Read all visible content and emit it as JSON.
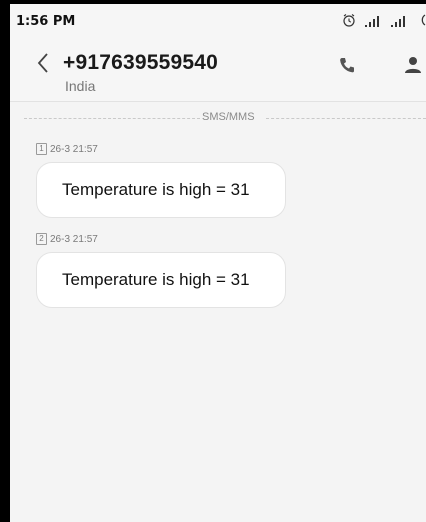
{
  "status_bar": {
    "time": "1:56 PM",
    "icons": [
      "alarm-icon",
      "signal-icon",
      "signal-icon",
      "battery-icon"
    ]
  },
  "header": {
    "title": "+917639559540",
    "subtitle": "India",
    "back_icon": "chevron-left-icon",
    "call_icon": "phone-icon",
    "contact_icon": "person-icon"
  },
  "section": {
    "label": "SMS/MMS"
  },
  "messages": [
    {
      "sim": "1",
      "timestamp": "26-3 21:57",
      "text": "Temperature is high = 31"
    },
    {
      "sim": "2",
      "timestamp": "26-3 21:57",
      "text": "Temperature is high = 31"
    }
  ],
  "colors": {
    "background": "#f4f4f4",
    "header_background": "#f6f6f6",
    "bubble_background": "#ffffff",
    "text": "#111111",
    "muted_text": "#777777"
  }
}
